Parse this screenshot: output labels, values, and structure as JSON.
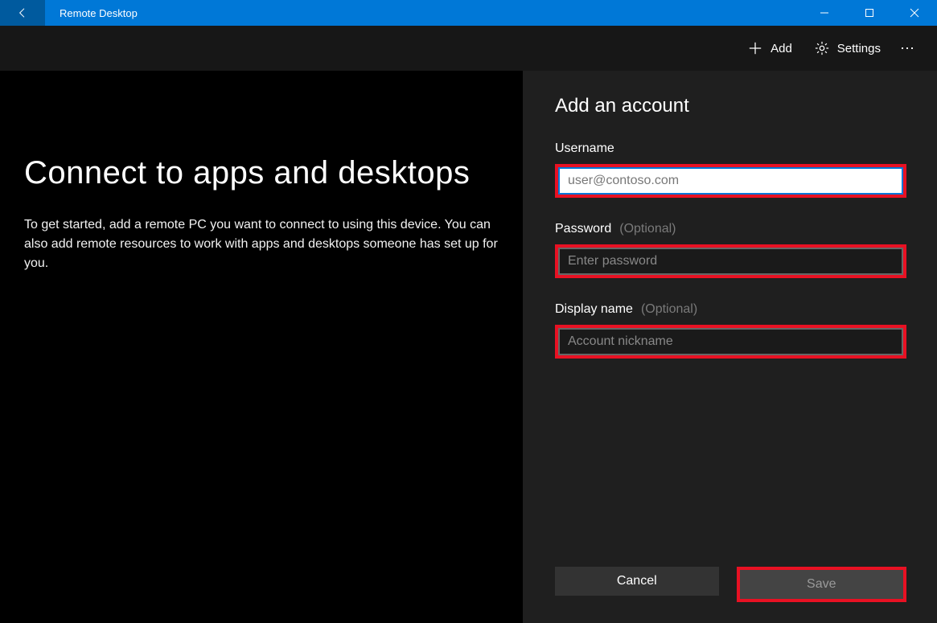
{
  "titlebar": {
    "app_title": "Remote Desktop"
  },
  "commandbar": {
    "add_label": "Add",
    "settings_label": "Settings"
  },
  "main": {
    "heading": "Connect to apps and desktops",
    "description": "To get started, add a remote PC you want to connect to using this device. You can also add remote resources to work with apps and desktops someone has set up for you."
  },
  "panel": {
    "heading": "Add an account",
    "username": {
      "label": "Username",
      "placeholder": "user@contoso.com",
      "value": ""
    },
    "password": {
      "label": "Password",
      "optional": "(Optional)",
      "placeholder": "Enter password",
      "value": ""
    },
    "displayname": {
      "label": "Display name",
      "optional": "(Optional)",
      "placeholder": "Account nickname",
      "value": ""
    },
    "cancel_label": "Cancel",
    "save_label": "Save"
  }
}
